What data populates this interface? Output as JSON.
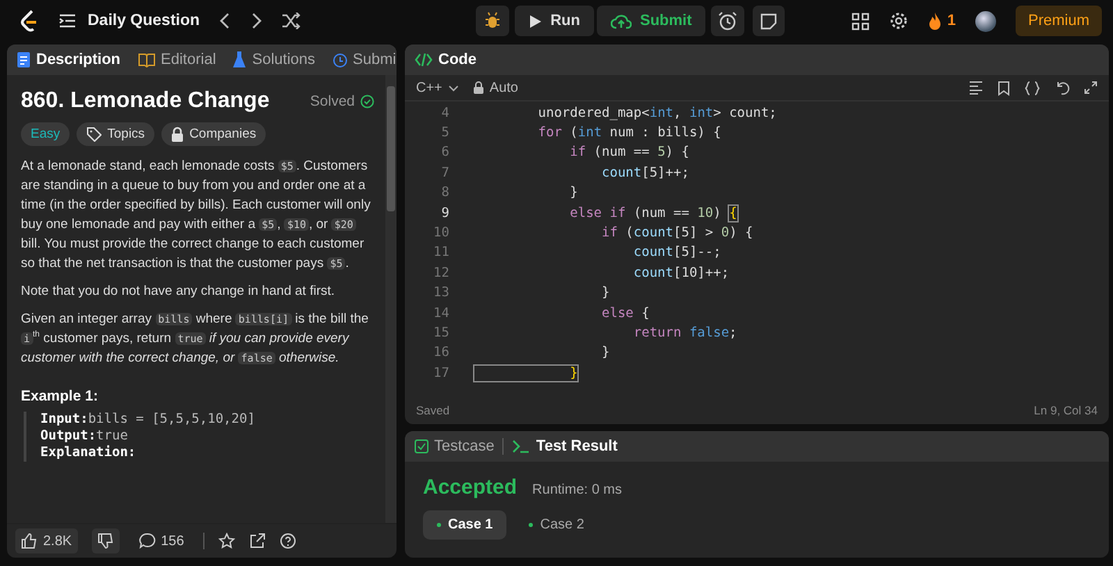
{
  "top_bar": {
    "nav_label": "Daily Question",
    "run_label": "Run",
    "submit_label": "Submit",
    "streak": "1",
    "premium_label": "Premium"
  },
  "description_panel": {
    "tabs": [
      {
        "label": "Description",
        "kind": "doc",
        "selected": true
      },
      {
        "label": "Editorial",
        "kind": "book",
        "selected": false
      },
      {
        "label": "Solutions",
        "kind": "flask",
        "selected": false
      },
      {
        "label": "Submi",
        "kind": "history",
        "selected": false
      }
    ],
    "title": "860. Lemonade Change",
    "status": "Solved",
    "difficulty": "Easy",
    "tags": [
      {
        "label": "Topics",
        "kind": "tag"
      },
      {
        "label": "Companies",
        "kind": "lock"
      }
    ],
    "paragraphs": [
      [
        {
          "t": "At a lemonade stand, each lemonade costs ",
          "kind": "text"
        },
        {
          "t": "$5",
          "kind": "code"
        },
        {
          "t": ". Customers are standing in a queue to buy from you and order one at a time (in the order specified by bills). Each customer will only buy one lemonade and pay with either a ",
          "kind": "text"
        },
        {
          "t": "$5",
          "kind": "code"
        },
        {
          "t": ", ",
          "kind": "text"
        },
        {
          "t": "$10",
          "kind": "code"
        },
        {
          "t": ", or ",
          "kind": "text"
        },
        {
          "t": "$20",
          "kind": "code"
        },
        {
          "t": " bill. You must provide the correct change to each customer so that the net transaction is that the customer pays ",
          "kind": "text"
        },
        {
          "t": "$5",
          "kind": "code"
        },
        {
          "t": ".",
          "kind": "text"
        }
      ],
      [
        {
          "t": "Note that you do not have any change in hand at first.",
          "kind": "text"
        }
      ],
      [
        {
          "t": "Given an integer array ",
          "kind": "text"
        },
        {
          "t": "bills",
          "kind": "code"
        },
        {
          "t": " where ",
          "kind": "text"
        },
        {
          "t": "bills[i]",
          "kind": "code"
        },
        {
          "t": " is the bill the ",
          "kind": "text"
        },
        {
          "t": "i",
          "kind": "code"
        },
        {
          "t": "th",
          "kind": "sup"
        },
        {
          "t": " customer pays, return ",
          "kind": "text"
        },
        {
          "t": "true",
          "kind": "code"
        },
        {
          "t": " if you can provide every customer with the correct change, or ",
          "kind": "italic"
        },
        {
          "t": "false",
          "kind": "code"
        },
        {
          "t": " otherwise.",
          "kind": "italic"
        }
      ]
    ],
    "example": {
      "heading": "Example 1:",
      "lines": [
        {
          "label": "Input:",
          "value": "bills = [5,5,5,10,20]"
        },
        {
          "label": "Output:",
          "value": "true"
        },
        {
          "label": "Explanation:"
        }
      ]
    },
    "likes": "2.8K",
    "comments": "156"
  },
  "editor": {
    "title": "Code",
    "language": "C++",
    "mode": "Auto",
    "lines": [
      {
        "number": "4",
        "current": false,
        "tokens": [
          {
            "t": "        unordered_map<",
            "kind": "plain"
          },
          {
            "t": "int",
            "kind": "type"
          },
          {
            "t": ", ",
            "kind": "plain"
          },
          {
            "t": "int",
            "kind": "type"
          },
          {
            "t": "> count;",
            "kind": "plain"
          }
        ]
      },
      {
        "number": "5",
        "current": false,
        "tokens": [
          {
            "t": "        for",
            "kind": "kw"
          },
          {
            "t": " (",
            "kind": "plain"
          },
          {
            "t": "int",
            "kind": "type"
          },
          {
            "t": " num : bills) {",
            "kind": "plain"
          }
        ]
      },
      {
        "number": "6",
        "current": false,
        "tokens": [
          {
            "t": "            if",
            "kind": "kw"
          },
          {
            "t": " (num == ",
            "kind": "plain"
          },
          {
            "t": "5",
            "kind": "num"
          },
          {
            "t": ") {",
            "kind": "plain"
          }
        ]
      },
      {
        "number": "7",
        "current": false,
        "tokens": [
          {
            "t": "                count",
            "kind": "var"
          },
          {
            "t": "[5]++;",
            "kind": "plain"
          }
        ]
      },
      {
        "number": "8",
        "current": false,
        "tokens": [
          {
            "t": "            }",
            "kind": "plain"
          }
        ]
      },
      {
        "number": "9",
        "current": true,
        "tokens": [
          {
            "t": "            else if",
            "kind": "kw"
          },
          {
            "t": " (num == ",
            "kind": "plain"
          },
          {
            "t": "10",
            "kind": "num"
          },
          {
            "t": ") ",
            "kind": "plain"
          },
          {
            "t": "{",
            "kind": "bracket"
          }
        ]
      },
      {
        "number": "10",
        "current": false,
        "tokens": [
          {
            "t": "                if",
            "kind": "kw"
          },
          {
            "t": " (",
            "kind": "plain"
          },
          {
            "t": "count",
            "kind": "var"
          },
          {
            "t": "[5] > ",
            "kind": "plain"
          },
          {
            "t": "0",
            "kind": "num"
          },
          {
            "t": ") {",
            "kind": "plain"
          }
        ]
      },
      {
        "number": "11",
        "current": false,
        "tokens": [
          {
            "t": "                    count",
            "kind": "var"
          },
          {
            "t": "[5]--;",
            "kind": "plain"
          }
        ]
      },
      {
        "number": "12",
        "current": false,
        "tokens": [
          {
            "t": "                    count",
            "kind": "var"
          },
          {
            "t": "[10]++;",
            "kind": "plain"
          }
        ]
      },
      {
        "number": "13",
        "current": false,
        "tokens": [
          {
            "t": "                }",
            "kind": "plain"
          }
        ]
      },
      {
        "number": "14",
        "current": false,
        "tokens": [
          {
            "t": "                else",
            "kind": "kw"
          },
          {
            "t": " {",
            "kind": "plain"
          }
        ]
      },
      {
        "number": "15",
        "current": false,
        "tokens": [
          {
            "t": "                    return",
            "kind": "kw"
          },
          {
            "t": " false",
            "kind": "type"
          },
          {
            "t": ";",
            "kind": "plain"
          }
        ]
      },
      {
        "number": "16",
        "current": false,
        "tokens": [
          {
            "t": "                }",
            "kind": "plain"
          }
        ]
      },
      {
        "number": "17",
        "current": false,
        "tokens": [
          {
            "t": "            }",
            "kind": "bracket"
          }
        ]
      }
    ],
    "status": "Saved",
    "cursor": "Ln 9, Col 34"
  },
  "test_panel": {
    "tabs": [
      {
        "label": "Testcase",
        "kind": "check",
        "selected": false
      },
      {
        "label": "Test Result",
        "kind": "terminal",
        "selected": true
      }
    ],
    "verdict": "Accepted",
    "runtime": "Runtime: 0 ms",
    "cases": [
      {
        "label": "Case 1",
        "selected": true
      },
      {
        "label": "Case 2",
        "selected": false
      }
    ]
  }
}
